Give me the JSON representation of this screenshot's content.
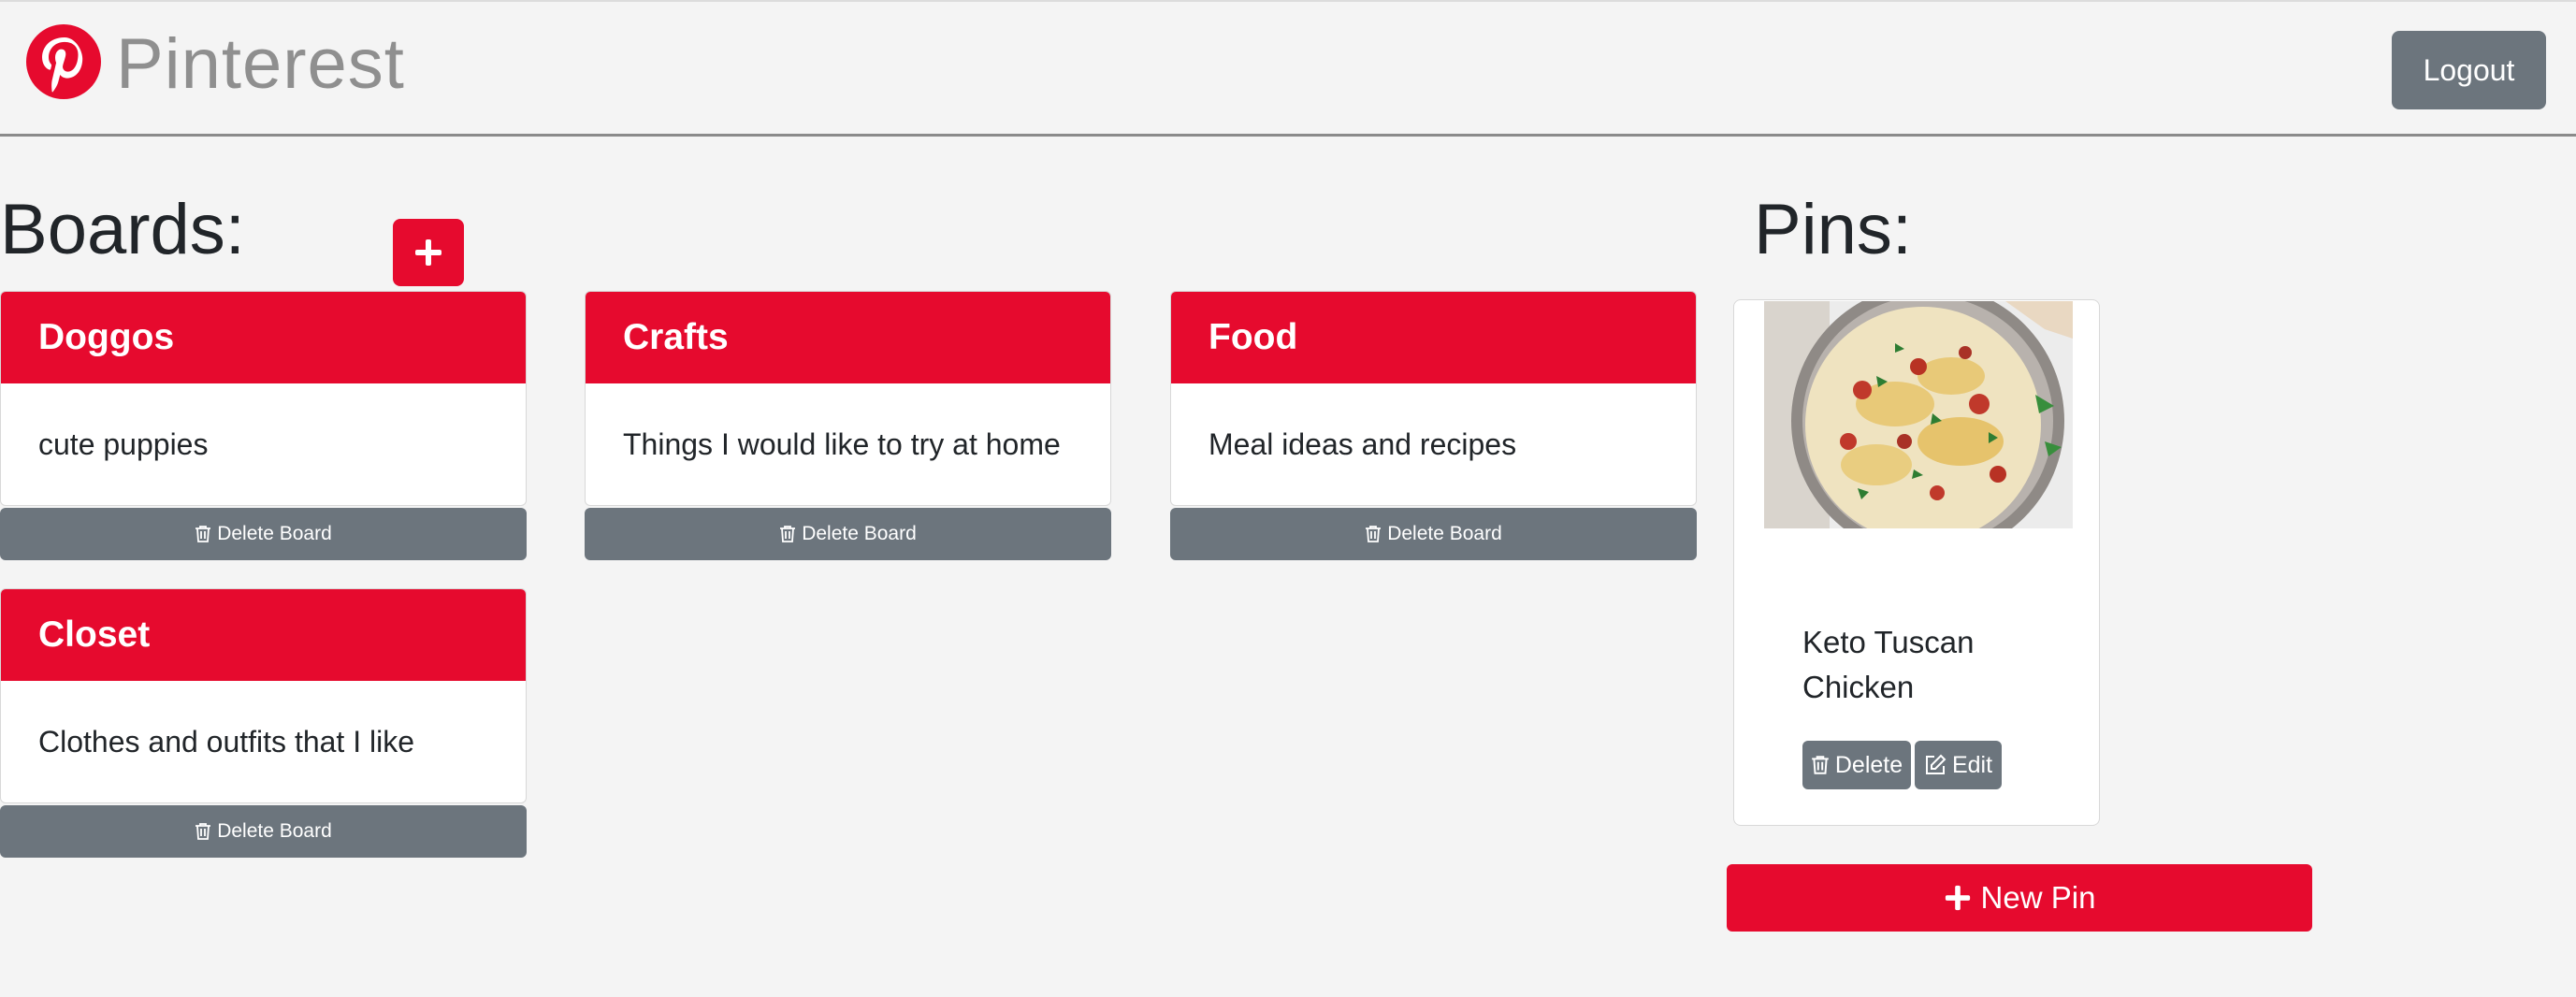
{
  "header": {
    "brand": "Pinterest",
    "logo_icon": "pinterest-logo-icon",
    "logout_label": "Logout"
  },
  "colors": {
    "brand_red": "#e60a2e",
    "secondary_gray": "#6c757d",
    "background": "#f4f4f4"
  },
  "boards": {
    "title": "Boards:",
    "add_icon": "plus-icon",
    "delete_label": "Delete Board",
    "delete_icon": "trash-icon",
    "items": [
      {
        "name": "Doggos",
        "description": "cute puppies"
      },
      {
        "name": "Crafts",
        "description": "Things I would like to try at home"
      },
      {
        "name": "Food",
        "description": "Meal ideas and recipes"
      },
      {
        "name": "Closet",
        "description": "Clothes and outfits that I like"
      }
    ]
  },
  "pins": {
    "title": "Pins:",
    "items": [
      {
        "title": "Keto Tuscan Chicken",
        "delete_label": "Delete",
        "edit_label": "Edit"
      }
    ],
    "new_pin_label": "New Pin"
  }
}
